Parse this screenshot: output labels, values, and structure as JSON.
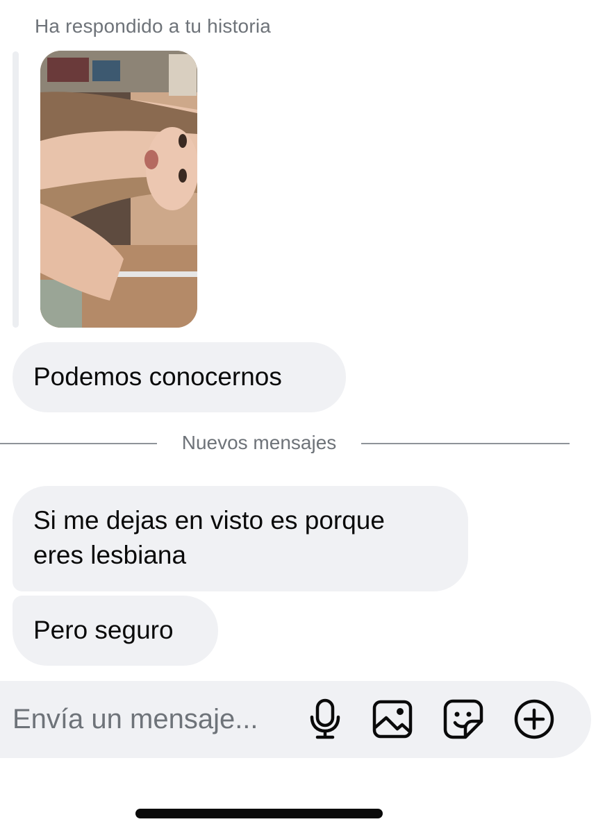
{
  "story_reply": {
    "label": "Ha respondido a tu historia"
  },
  "messages": [
    {
      "text": "Podemos conocernos"
    },
    {
      "text": "Si me dejas en visto es porque\neres lesbiana"
    },
    {
      "text": "Pero seguro"
    }
  ],
  "divider": {
    "label": "Nuevos mensajes"
  },
  "composer": {
    "placeholder": "Envía un mensaje...",
    "icons": [
      "microphone-icon",
      "image-icon",
      "sticker-icon",
      "plus-circle-icon"
    ]
  },
  "colors": {
    "bubble_background": "#f0f1f4",
    "secondary_text": "#6e7379",
    "primary_text": "#0a0a0a"
  }
}
